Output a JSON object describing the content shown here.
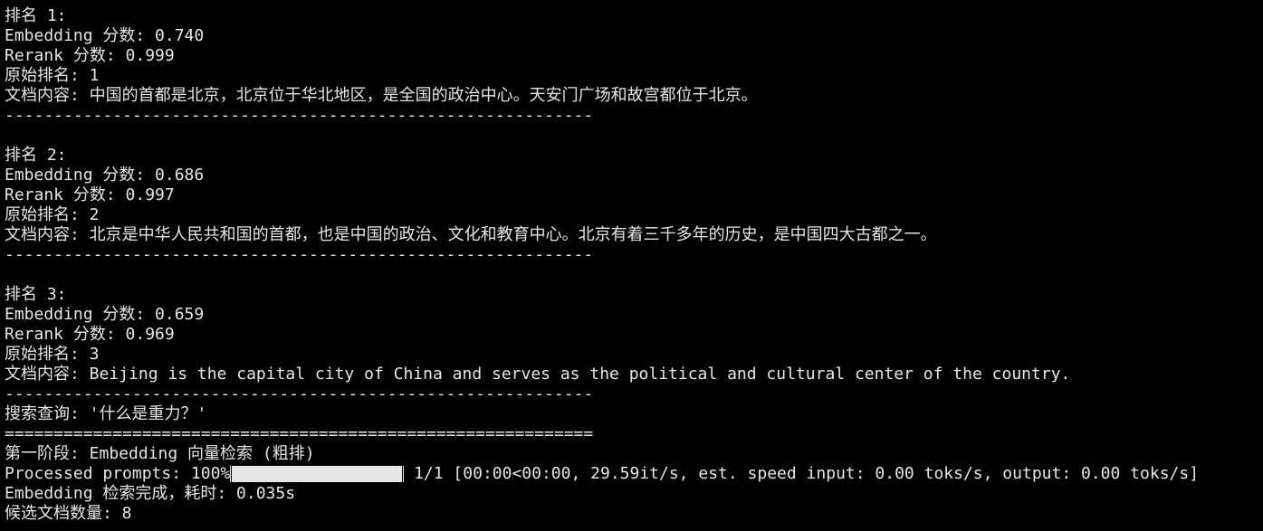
{
  "colors": {
    "background": "#000000",
    "text": "#e6e6e6"
  },
  "terminal": {
    "results": [
      {
        "rank": "排名 1:",
        "embedding": "Embedding 分数: 0.740",
        "rerank": "Rerank 分数: 0.999",
        "original_rank": "原始排名: 1",
        "content": "文档内容: 中国的首都是北京，北京位于华北地区，是全国的政治中心。天安门广场和故宫都位于北京。",
        "separator": "------------------------------------------------------------"
      },
      {
        "rank": "排名 2:",
        "embedding": "Embedding 分数: 0.686",
        "rerank": "Rerank 分数: 0.997",
        "original_rank": "原始排名: 2",
        "content": "文档内容: 北京是中华人民共和国的首都，也是中国的政治、文化和教育中心。北京有着三千多年的历史，是中国四大古都之一。",
        "separator": "------------------------------------------------------------"
      },
      {
        "rank": "排名 3:",
        "embedding": "Embedding 分数: 0.659",
        "rerank": "Rerank 分数: 0.969",
        "original_rank": "原始排名: 3",
        "content": "文档内容: Beijing is the capital city of China and serves as the political and cultural center of the country.",
        "separator": "------------------------------------------------------------"
      }
    ],
    "query_line": "搜索查询: '什么是重力？'",
    "double_separator": "============================================================",
    "stage_line": "第一阶段: Embedding 向量检索 (粗排)",
    "progress": {
      "prefix": "Processed prompts: 100%",
      "fraction": 1.0,
      "suffix": " 1/1 [00:00<00:00, 29.59it/s, est. speed input: 0.00 toks/s, output: 0.00 toks/s]"
    },
    "done_line": "Embedding 检索完成，耗时: 0.035s",
    "candidates_line": "候选文档数量: 8"
  }
}
